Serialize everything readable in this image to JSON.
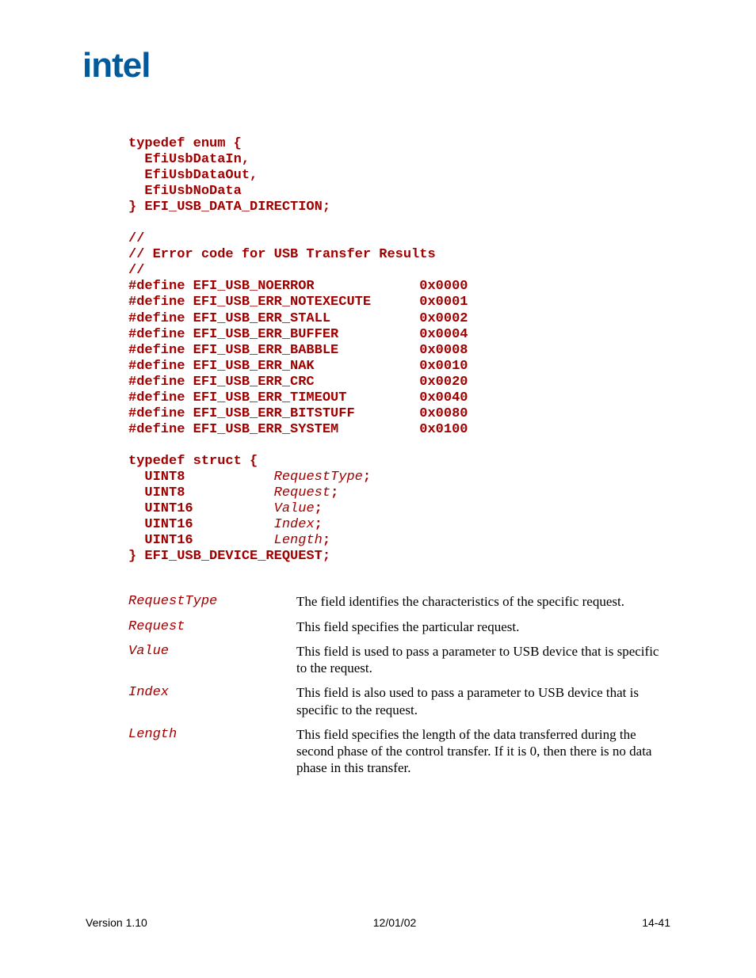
{
  "logo": "intel",
  "code": {
    "enum_open": "typedef enum {",
    "enum_l1": "  EfiUsbDataIn,",
    "enum_l2": "  EfiUsbDataOut,",
    "enum_l3": "  EfiUsbNoData",
    "enum_close": "} EFI_USB_DATA_DIRECTION;",
    "c1": "//",
    "c2": "// Error code for USB Transfer Results",
    "c3": "//",
    "d1": "#define EFI_USB_NOERROR             0x0000",
    "d2": "#define EFI_USB_ERR_NOTEXECUTE      0x0001",
    "d3": "#define EFI_USB_ERR_STALL           0x0002",
    "d4": "#define EFI_USB_ERR_BUFFER          0x0004",
    "d5": "#define EFI_USB_ERR_BABBLE          0x0008",
    "d6": "#define EFI_USB_ERR_NAK             0x0010",
    "d7": "#define EFI_USB_ERR_CRC             0x0020",
    "d8": "#define EFI_USB_ERR_TIMEOUT         0x0040",
    "d9": "#define EFI_USB_ERR_BITSTUFF        0x0080",
    "d10": "#define EFI_USB_ERR_SYSTEM          0x0100",
    "struct_open": "typedef struct {",
    "s1_t": "  UINT8           ",
    "s1_p": "RequestType",
    "s1_e": ";",
    "s2_t": "  UINT8           ",
    "s2_p": "Request",
    "s2_e": ";",
    "s3_t": "  UINT16          ",
    "s3_p": "Value",
    "s3_e": ";",
    "s4_t": "  UINT16          ",
    "s4_p": "Index",
    "s4_e": ";",
    "s5_t": "  UINT16          ",
    "s5_p": "Length",
    "s5_e": ";",
    "struct_close": "} EFI_USB_DEVICE_REQUEST;"
  },
  "desc": [
    {
      "term": "RequestType",
      "def": "The field identifies the characteristics of the specific request."
    },
    {
      "term": "Request",
      "def": "This field specifies the particular request."
    },
    {
      "term": "Value",
      "def": "This field is used to pass a parameter to USB device that is specific to the request."
    },
    {
      "term": "Index",
      "def": "This field is also used to pass a parameter to USB device that is specific to the request."
    },
    {
      "term": "Length",
      "def": "This field specifies the length of the data transferred during the second phase of the control transfer.  If it is 0, then there is no data phase in this transfer."
    }
  ],
  "footer": {
    "left": "Version 1.10",
    "center": "12/01/02",
    "right": "14-41"
  }
}
